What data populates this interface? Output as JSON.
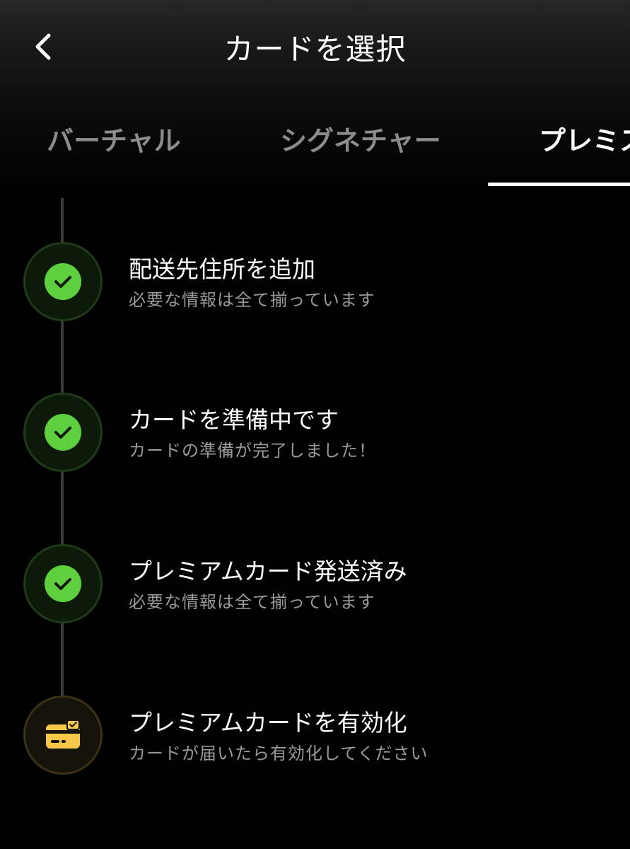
{
  "header": {
    "title": "カードを選択"
  },
  "tabs": [
    {
      "label": "バーチャル",
      "active": false
    },
    {
      "label": "シグネチャー",
      "active": false
    },
    {
      "label": "プレミス",
      "active": true
    }
  ],
  "steps": [
    {
      "title": "配送先住所を追加",
      "subtitle": "必要な情報は全て揃っています",
      "status": "done",
      "icon": "check-icon"
    },
    {
      "title": "カードを準備中です",
      "subtitle": "カードの準備が完了しました！",
      "status": "done",
      "icon": "check-icon"
    },
    {
      "title": "プレミアムカード発送済み",
      "subtitle": "必要な情報は全て揃っています",
      "status": "done",
      "icon": "check-icon"
    },
    {
      "title": "プレミアムカードを有効化",
      "subtitle": "カードが届いたら有効化してください",
      "status": "pending",
      "icon": "card-check-icon"
    }
  ],
  "colors": {
    "background": "#000000",
    "done_green": "#5ecf3f",
    "pending_yellow": "#f7c948",
    "muted_text": "#9a9a9a",
    "inactive_tab": "#8c8c8c"
  }
}
